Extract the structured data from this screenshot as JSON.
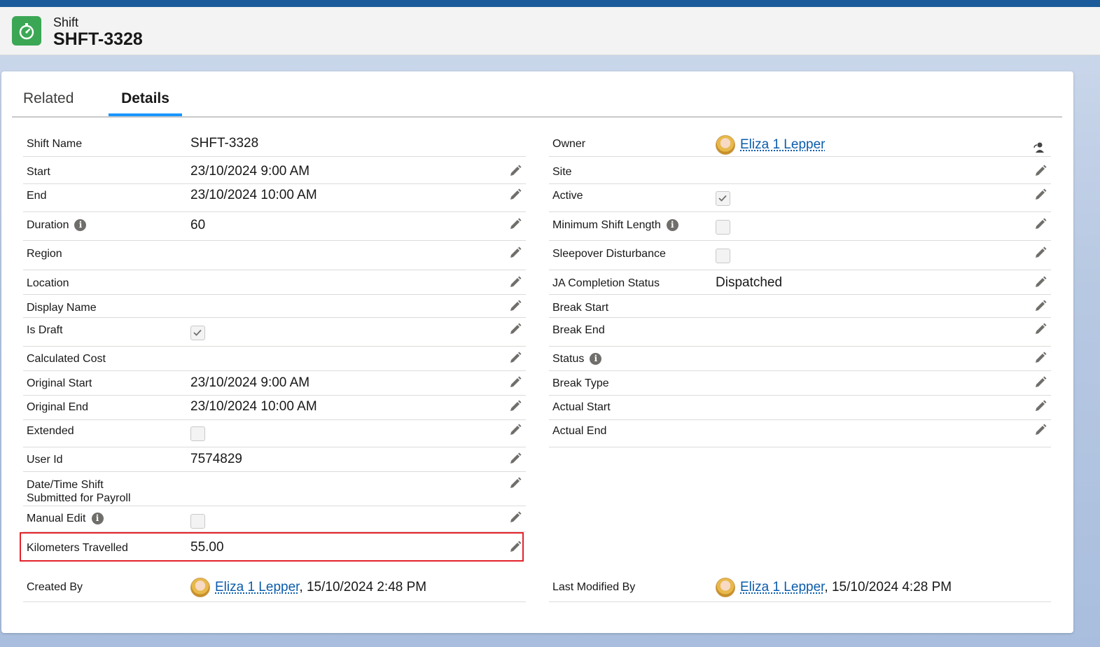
{
  "header": {
    "object_label": "Shift",
    "record_title": "SHFT-3328"
  },
  "tabs": [
    {
      "label": "Related"
    },
    {
      "label": "Details"
    }
  ],
  "left": {
    "shift_name": {
      "label": "Shift Name",
      "value": "SHFT-3328"
    },
    "start": {
      "label": "Start",
      "value": "23/10/2024 9:00 AM"
    },
    "end": {
      "label": "End",
      "value": "23/10/2024 10:00 AM"
    },
    "duration": {
      "label": "Duration",
      "value": "60"
    },
    "region": {
      "label": "Region",
      "value": ""
    },
    "location": {
      "label": "Location",
      "value": ""
    },
    "display_name": {
      "label": "Display Name",
      "value": ""
    },
    "is_draft": {
      "label": "Is Draft",
      "checked": true
    },
    "calculated_cost": {
      "label": "Calculated Cost",
      "value": ""
    },
    "original_start": {
      "label": "Original Start",
      "value": "23/10/2024 9:00 AM"
    },
    "original_end": {
      "label": "Original End",
      "value": "23/10/2024 10:00 AM"
    },
    "extended": {
      "label": "Extended",
      "checked": false
    },
    "user_id": {
      "label": "User Id",
      "value": "7574829"
    },
    "payroll": {
      "label_line1": "Date/Time Shift",
      "label_line2": "Submitted for Payroll",
      "value": ""
    },
    "manual_edit": {
      "label": "Manual Edit",
      "checked": false
    },
    "km": {
      "label": "Kilometers Travelled",
      "value": "55.00"
    },
    "created_by": {
      "label": "Created By",
      "user": "Eliza 1 Lepper",
      "date": ", 15/10/2024 2:48 PM"
    }
  },
  "right": {
    "owner": {
      "label": "Owner",
      "user": "Eliza 1 Lepper"
    },
    "site": {
      "label": "Site",
      "value": ""
    },
    "active": {
      "label": "Active",
      "checked": true
    },
    "min_shift": {
      "label": "Minimum Shift Length",
      "checked": false
    },
    "sleepover": {
      "label": "Sleepover Disturbance",
      "checked": false
    },
    "ja_status": {
      "label": "JA Completion Status",
      "value": "Dispatched"
    },
    "break_start": {
      "label": "Break Start",
      "value": ""
    },
    "break_end": {
      "label": "Break End",
      "value": ""
    },
    "status": {
      "label": "Status",
      "value": ""
    },
    "break_type": {
      "label": "Break Type",
      "value": ""
    },
    "actual_start": {
      "label": "Actual Start",
      "value": ""
    },
    "actual_end": {
      "label": "Actual End",
      "value": ""
    },
    "last_modified_by": {
      "label": "Last Modified By",
      "user": "Eliza 1 Lepper",
      "date": ", 15/10/2024 4:28 PM"
    }
  },
  "colors": {
    "brand_green": "#3ba755",
    "link": "#0b5cab",
    "highlight": "#e4222b",
    "tab_active": "#1b96ff"
  },
  "icons": [
    "stopwatch-icon",
    "pencil-icon",
    "info-icon",
    "checkmark-icon",
    "change-owner-icon",
    "avatar"
  ]
}
